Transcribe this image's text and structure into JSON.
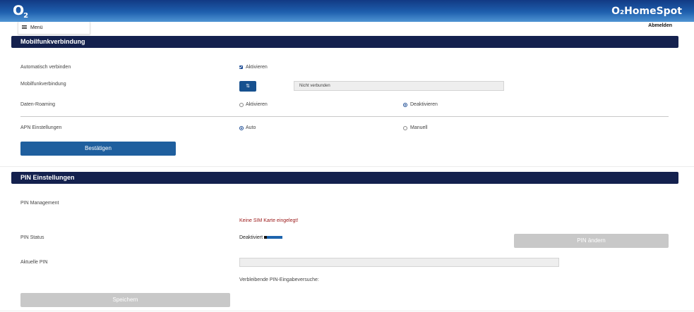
{
  "header": {
    "logo_main": "O",
    "logo_sub": "2",
    "product_name": "O₂HomeSpot",
    "menu_label": "Menü",
    "logout_label": "Abmelden"
  },
  "mobile_section": {
    "title": "Mobilfunkverbindung",
    "auto_connect": {
      "label": "Automatisch verbinden",
      "option": "Aktivieren",
      "checked": true
    },
    "connection": {
      "label": "Mobilfunkverbindung",
      "button_icon": "connection-toggle-icon",
      "button_glyph": "⇅",
      "status": "Nicht verbunden"
    },
    "roaming": {
      "label": "Daten-Roaming",
      "option_on": "Aktivieren",
      "option_off": "Deaktivieren",
      "selected": "Deaktivieren"
    },
    "apn": {
      "label": "APN Einstellungen",
      "option_auto": "Auto",
      "option_manual": "Manuell",
      "selected": "Auto"
    },
    "confirm_label": "Bestätigen"
  },
  "pin_section": {
    "title": "PIN Einstellungen",
    "management_label": "PIN Management",
    "warning": "Keine SIM Karte eingelegt!",
    "status_label": "PIN Status",
    "status_value": "Deaktiviert",
    "change_pin_label": "PIN ändern",
    "current_pin_label": "Aktuelle PIN",
    "current_pin_value": "",
    "attempts_label": "Verbleibende PIN-Eingabeversuche:",
    "save_label": "Speichern"
  },
  "colors": {
    "header_gradient_top": "#123a84",
    "header_gradient_bottom": "#4f94d3",
    "section_bar": "#14214e",
    "primary_button": "#1f5f9e",
    "disabled_button": "#c8c8c8",
    "warning_text": "#9b1818"
  }
}
